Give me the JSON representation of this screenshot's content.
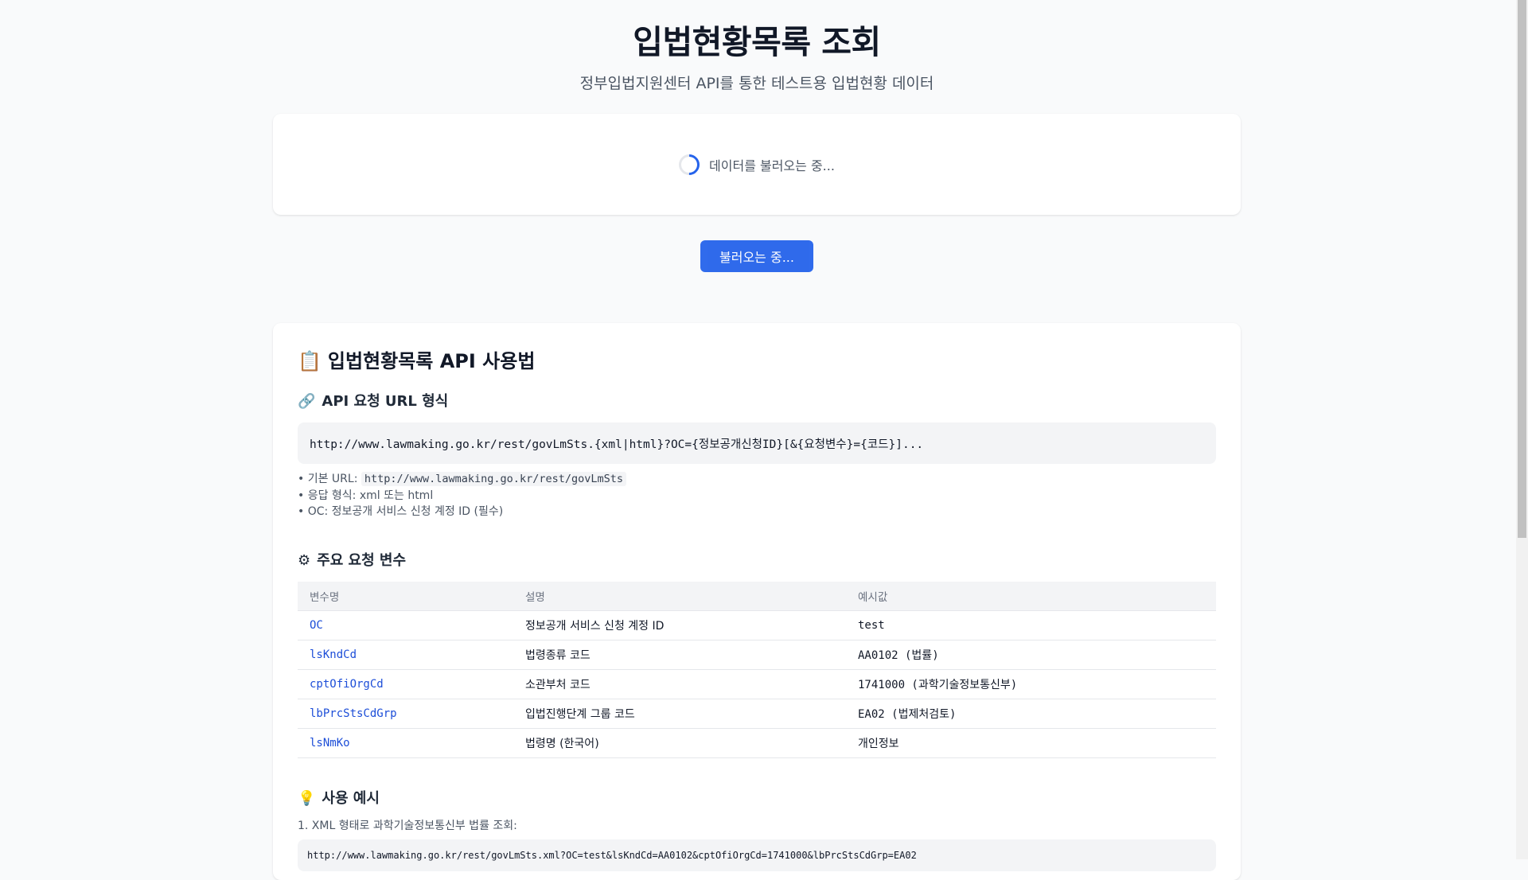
{
  "header": {
    "title": "입법현황목록 조회",
    "subtitle": "정부입법지원센터 API를 통한 테스트용 입법현황 데이터"
  },
  "loading": {
    "text": "데이터를 불러오는 중..."
  },
  "load_button": {
    "label": "불러오는 중..."
  },
  "guide": {
    "title": "입법현황목록 API 사용법",
    "title_icon": "📋",
    "url_section": {
      "icon": "🔗",
      "heading": "API 요청 URL 형식",
      "url_format": "http://www.lawmaking.go.kr/rest/govLmSts.{xml|html}?OC={정보공개신청ID}[&{요청변수}={코드}]...",
      "bullets": [
        {
          "prefix": "• 기본 URL: ",
          "code": "http://www.lawmaking.go.kr/rest/govLmSts"
        },
        {
          "prefix": "• 응답 형식: xml 또는 html",
          "code": ""
        },
        {
          "prefix": "• OC: 정보공개 서비스 신청 계정 ID (필수)",
          "code": ""
        }
      ]
    },
    "params_section": {
      "icon": "⚙",
      "heading": "주요 요청 변수",
      "columns": [
        "변수명",
        "설명",
        "예시값"
      ],
      "rows": [
        {
          "name": "OC",
          "desc": "정보공개 서비스 신청 계정 ID",
          "example": "test"
        },
        {
          "name": "lsKndCd",
          "desc": "법령종류 코드",
          "example": "AA0102 (법률)"
        },
        {
          "name": "cptOfiOrgCd",
          "desc": "소관부처 코드",
          "example": "1741000 (과학기술정보통신부)"
        },
        {
          "name": "lbPrcStsCdGrp",
          "desc": "입법진행단계 그룹 코드",
          "example": "EA02 (법제처검토)"
        },
        {
          "name": "lsNmKo",
          "desc": "법령명 (한국어)",
          "example": "개인정보"
        }
      ]
    },
    "examples_section": {
      "icon": "💡",
      "heading": "사용 예시",
      "examples": [
        {
          "label": "1. XML 형태로 과학기술정보통신부 법률 조회:",
          "url": "http://www.lawmaking.go.kr/rest/govLmSts.xml?OC=test&lsKndCd=AA0102&cptOfiOrgCd=1741000&lbPrcStsCdGrp=EA02"
        }
      ]
    }
  },
  "colors": {
    "accent": "#2563eb",
    "background": "#f9fafb",
    "code_bg": "#f3f4f6"
  }
}
